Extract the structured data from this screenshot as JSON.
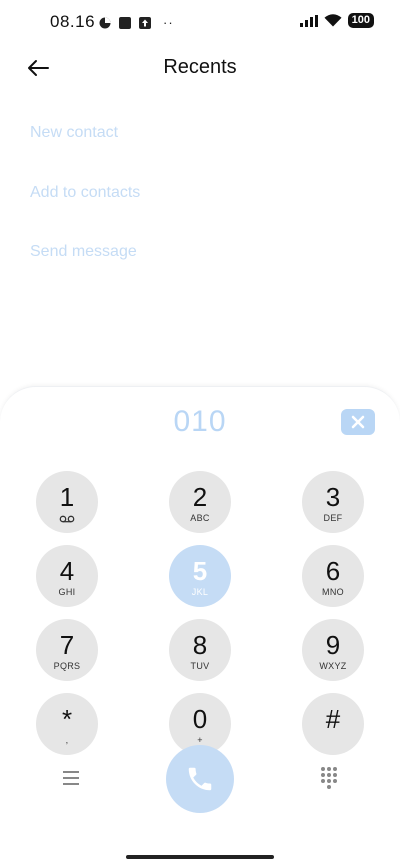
{
  "status_bar": {
    "time": "08.16",
    "dots": "··",
    "battery": "100",
    "icons": [
      "data-saver-icon",
      "square-notification-icon",
      "upload-icon",
      "signal-icon",
      "wifi-icon",
      "battery-icon"
    ]
  },
  "header": {
    "title": "Recents",
    "back_icon": "arrow-left-icon"
  },
  "actions": [
    {
      "label": "New contact"
    },
    {
      "label": "Add to contacts"
    },
    {
      "label": "Send message"
    }
  ],
  "dialer": {
    "number": "010",
    "keys": [
      {
        "digit": "1",
        "letters": "",
        "icon": "voicemail-icon"
      },
      {
        "digit": "2",
        "letters": "ABC"
      },
      {
        "digit": "3",
        "letters": "DEF"
      },
      {
        "digit": "4",
        "letters": "GHI"
      },
      {
        "digit": "5",
        "letters": "JKL"
      },
      {
        "digit": "6",
        "letters": "MNO"
      },
      {
        "digit": "7",
        "letters": "PQRS"
      },
      {
        "digit": "8",
        "letters": "TUV"
      },
      {
        "digit": "9",
        "letters": "WXYZ"
      },
      {
        "digit": "*",
        "letters": ","
      },
      {
        "digit": "0",
        "letters": "+"
      },
      {
        "digit": "#",
        "letters": ""
      }
    ],
    "active_key": "5",
    "colors": {
      "accent_light": "#c5dcf5",
      "key_bg": "#e6e6e6"
    }
  }
}
